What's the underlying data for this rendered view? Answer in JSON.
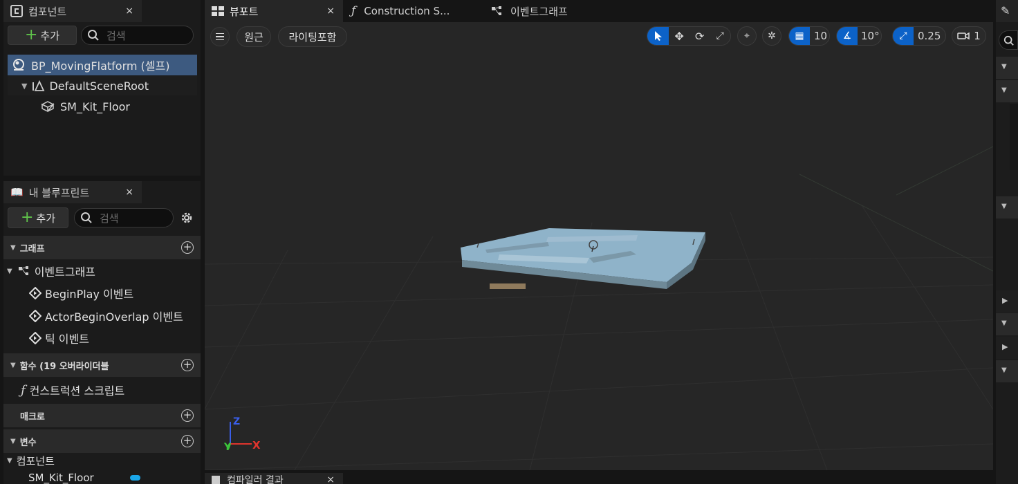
{
  "components_panel": {
    "tab_title": "컴포넌트",
    "close": "×",
    "add_label": "추가",
    "search_placeholder": "검색",
    "root_item": "BP_MovingFlatform (셀프)",
    "children": [
      "DefaultSceneRoot",
      "SM_Kit_Floor"
    ]
  },
  "blueprint_panel": {
    "tab_title": "내 블루프린트",
    "close": "×",
    "add_label": "추가",
    "search_placeholder": "검색",
    "sections": {
      "graph": "그래프",
      "functions": "함수 (19 오버라이더블",
      "macro": "매크로",
      "variables": "변수"
    },
    "event_graph": "이벤트그래프",
    "events": [
      "BeginPlay 이벤트",
      "ActorBeginOverlap 이벤트",
      "틱 이벤트"
    ],
    "construction_script": "컨스트럭션 스크립트",
    "components_group": "컴포넌트",
    "component_var": "SM_Kit_Floor"
  },
  "editor_tabs": [
    {
      "label": "뷰포트",
      "close": "×"
    },
    {
      "label": "Construction S..."
    },
    {
      "label": "이벤트그래프"
    }
  ],
  "viewport_toolbar": {
    "perspective": "원근",
    "lighting": "라이팅포함",
    "grid_snap": "10",
    "rotation_snap": "10°",
    "scale_snap": "0.25",
    "camera_speed": "1"
  },
  "axis_labels": {
    "z": "Z",
    "x": "X",
    "y": "Y"
  },
  "bottom_tab": "컴파일러 결과",
  "colors": {
    "accent_blue": "#0c62c8",
    "selected_row": "#3d5a80",
    "panel_bg": "#1a1a1a",
    "viewport_bg": "#262626",
    "add_plus": "#5fc24a",
    "axis_x": "#e0342d",
    "axis_y": "#3bc43b",
    "axis_z": "#3a5ee8"
  }
}
